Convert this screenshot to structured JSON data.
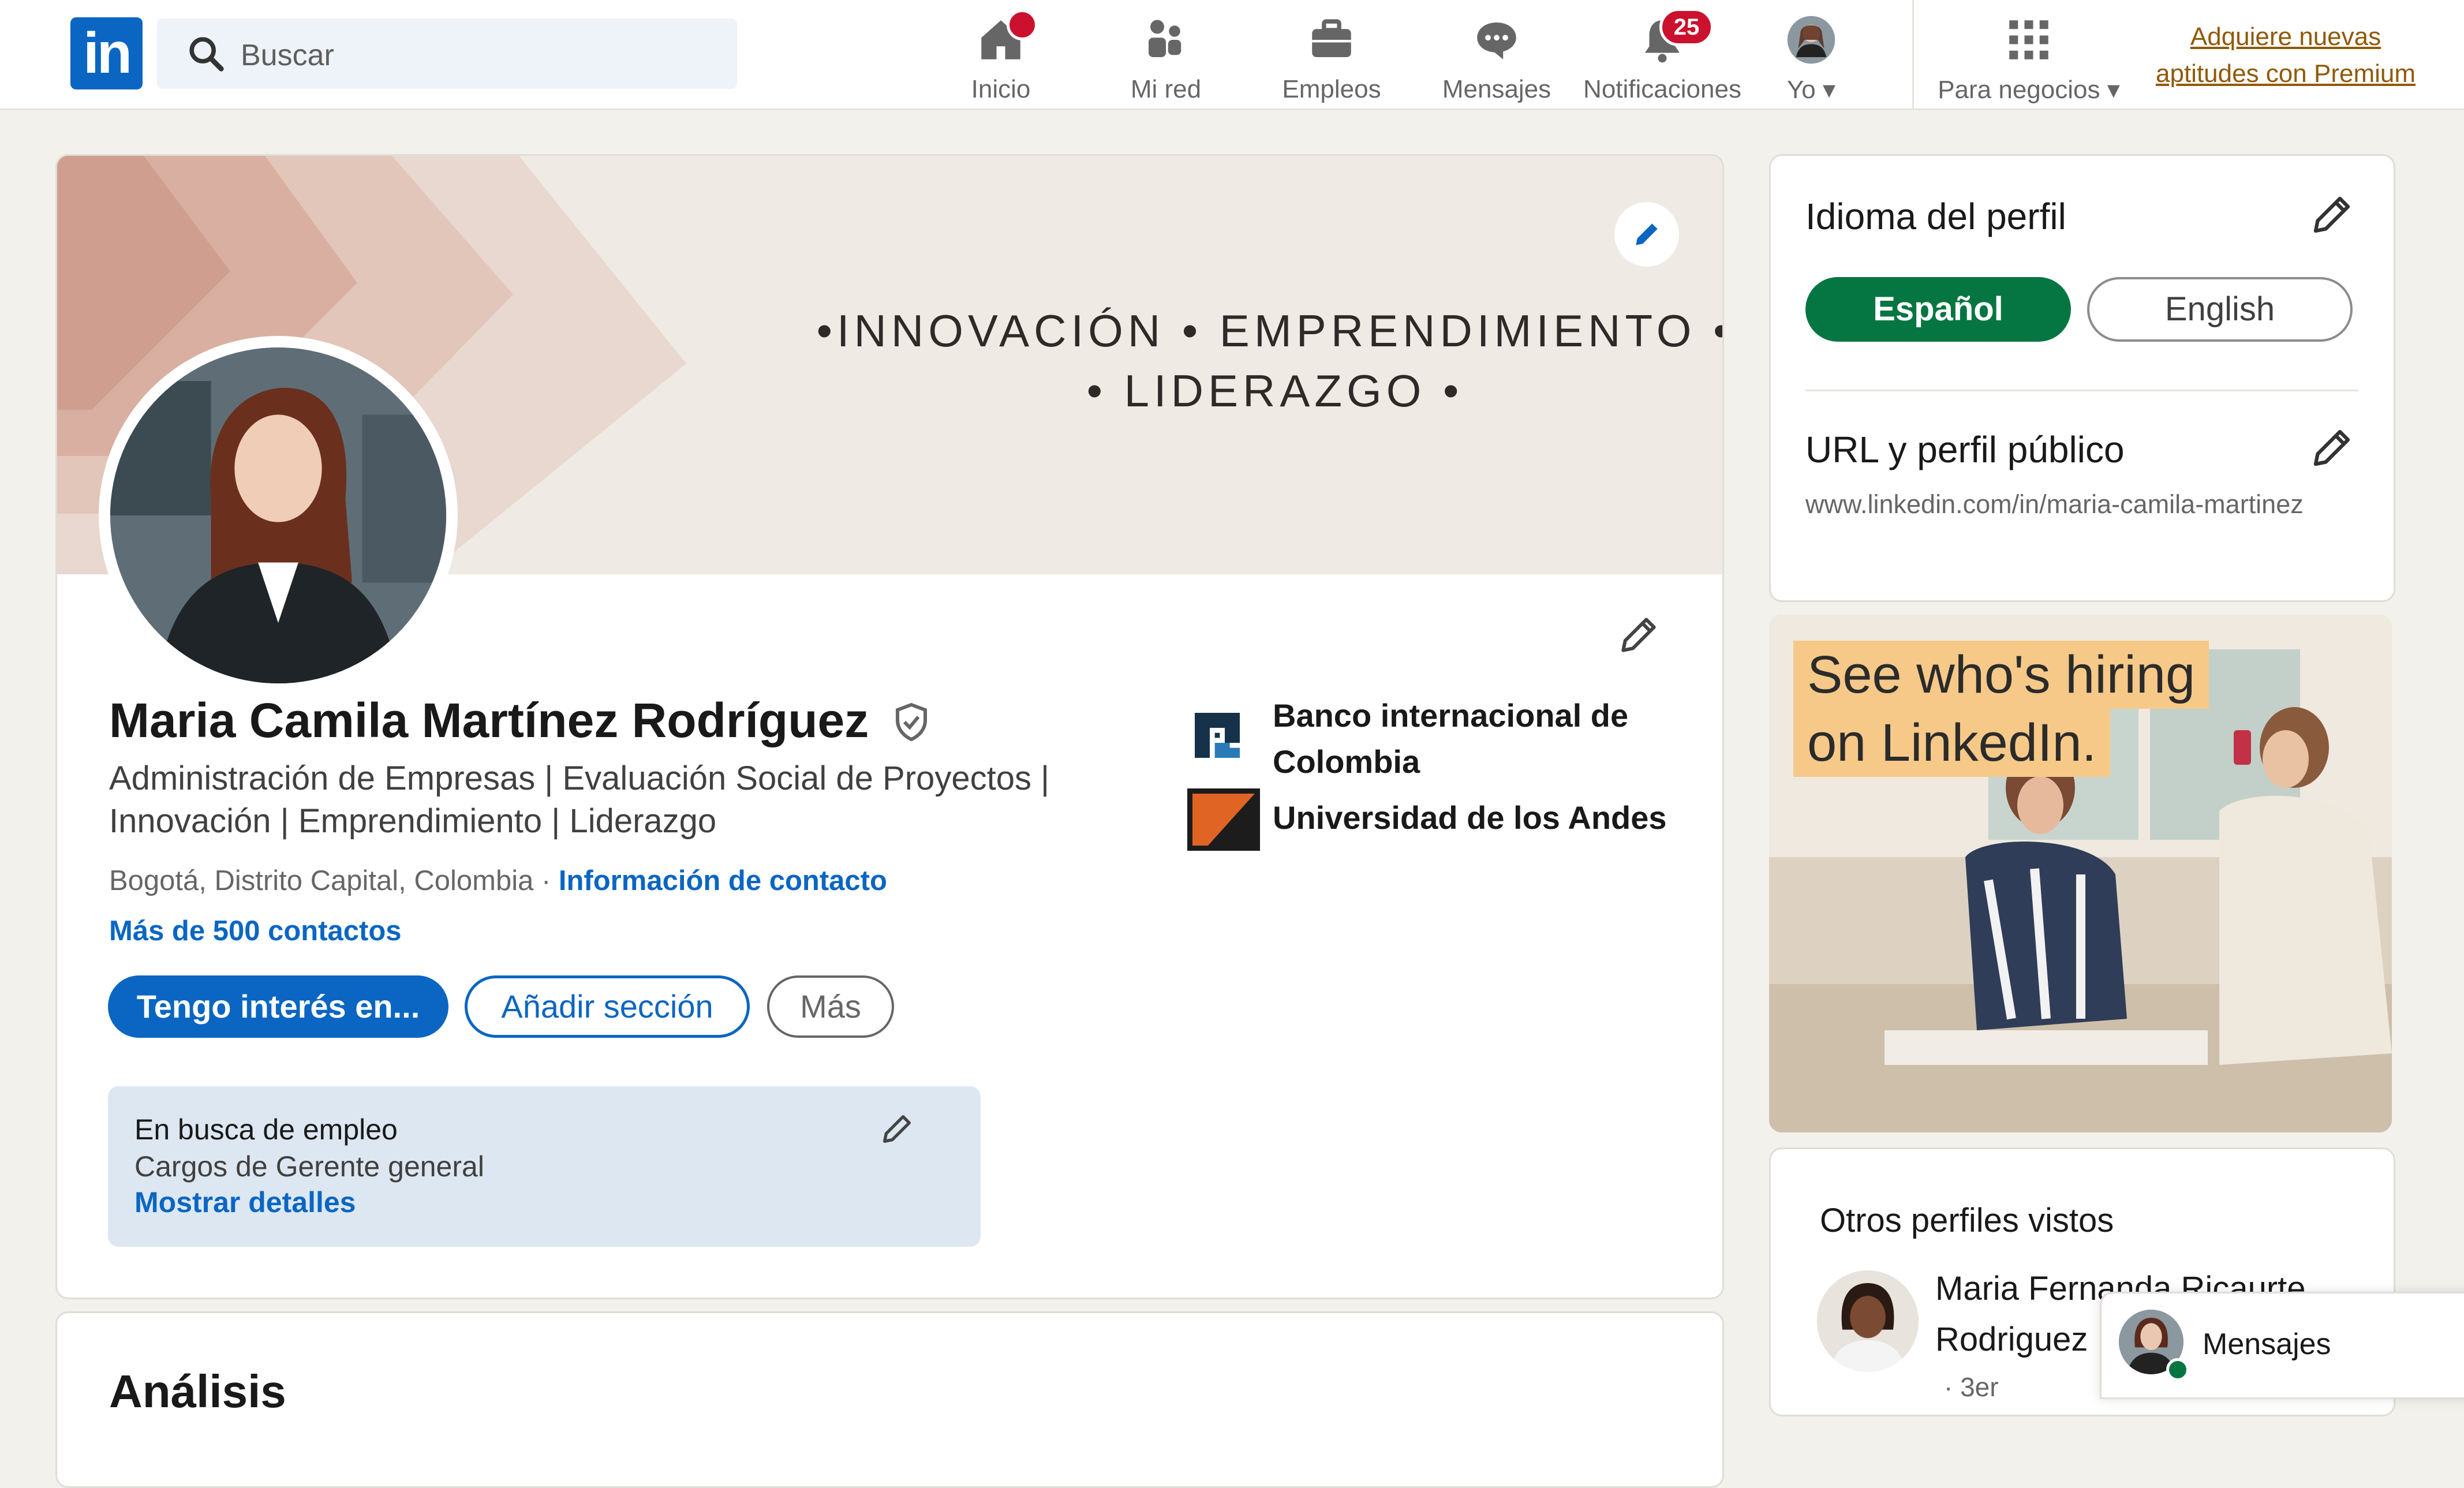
{
  "nav": {
    "search_placeholder": "Buscar",
    "items": [
      {
        "label": "Inicio",
        "icon": "home-icon"
      },
      {
        "label": "Mi red",
        "icon": "network-icon"
      },
      {
        "label": "Empleos",
        "icon": "briefcase-icon"
      },
      {
        "label": "Mensajes",
        "icon": "messaging-icon"
      },
      {
        "label": "Notificaciones",
        "icon": "bell-icon",
        "badge": "25"
      },
      {
        "label": "Yo",
        "icon": "avatar-icon"
      }
    ],
    "business_label": "Para negocios",
    "premium_line1": "Adquiere nuevas",
    "premium_line2": "aptitudes con Premium",
    "brand_color": "#0a66c2"
  },
  "profile": {
    "cover_line1": "•INNOVACIÓN • EMPRENDIMIENTO •",
    "cover_line2": "• LIDERAZGO •",
    "name": "Maria Camila Martínez Rodríguez",
    "headline_line1": "Administración de Empresas | Evaluación Social de Proyectos |",
    "headline_line2": "Innovación | Emprendimiento | Liderazgo",
    "location": "Bogotá, Distrito Capital, Colombia",
    "location_sep": " · ",
    "contact_info": "Información de contacto",
    "connections": "Más de 500 contactos",
    "btn_open_to": "Tengo interés en...",
    "btn_add_section": "Añadir sección",
    "btn_more": "Más",
    "open_to_work": {
      "title": "En busca de empleo",
      "roles": "Cargos de Gerente general",
      "details_link": "Mostrar detalles"
    },
    "org_company_line1": "Banco internacional de",
    "org_company_line2": "Colombia",
    "org_school": "Universidad de los Andes"
  },
  "analysis": {
    "title": "Análisis"
  },
  "sidebar": {
    "lang_title": "Idioma del perfil",
    "lang_spanish": "Español",
    "lang_english": "English",
    "url_title": "URL y perfil público",
    "url_value": "www.linkedin.com/in/maria-camila-martinez",
    "ad_line1": "See who's hiring",
    "ad_line2": "on LinkedIn.",
    "others_title": "Otros perfiles vistos",
    "other_profile_name1": "Maria Fernanda Ricaurte",
    "other_profile_name2": "Rodriguez",
    "other_profile_degree": "· 3er"
  },
  "messaging": {
    "label": "Mensajes"
  }
}
